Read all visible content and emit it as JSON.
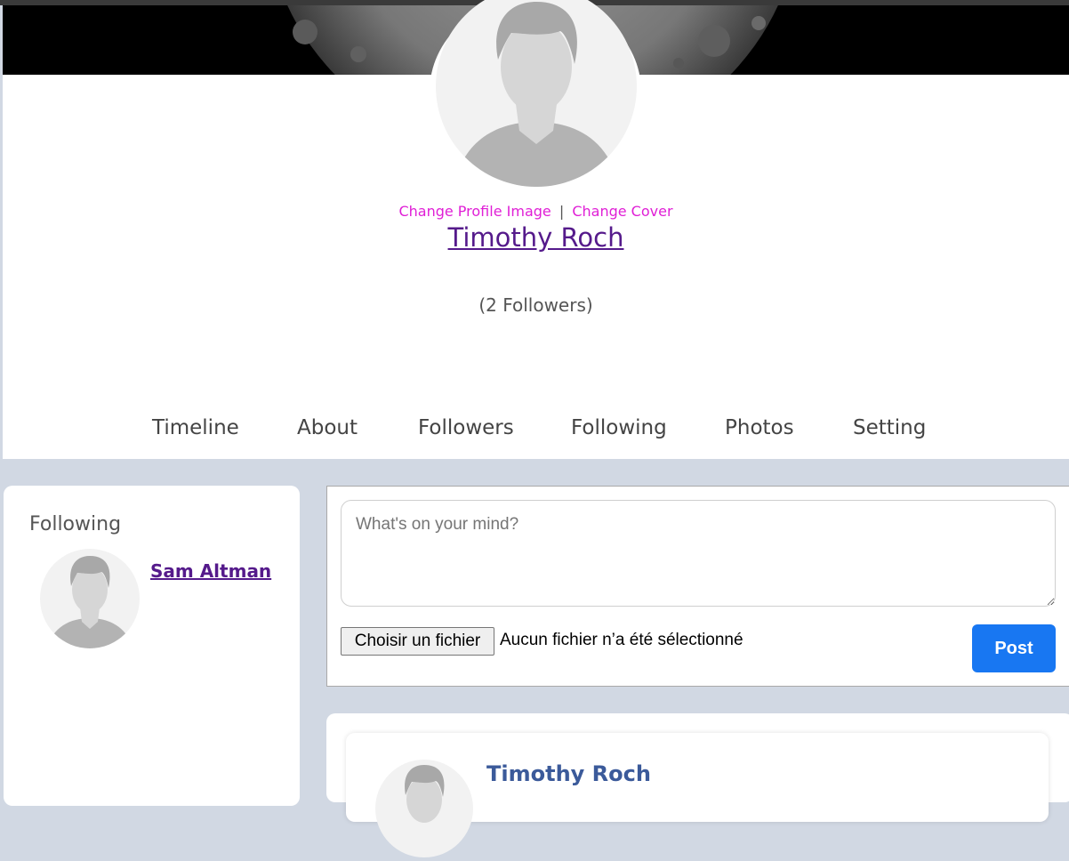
{
  "profile": {
    "change_profile_image": "Change Profile Image",
    "separator": "|",
    "change_cover": "Change Cover",
    "name": "Timothy Roch",
    "followers": "(2 Followers)"
  },
  "tabs": [
    {
      "label": "Timeline"
    },
    {
      "label": "About"
    },
    {
      "label": "Followers"
    },
    {
      "label": "Following"
    },
    {
      "label": "Photos"
    },
    {
      "label": "Setting"
    }
  ],
  "sidebar": {
    "title": "Following",
    "items": [
      {
        "name": "Sam Altman"
      }
    ]
  },
  "composer": {
    "placeholder": "What's on your mind?",
    "file_button": "Choisir un fichier",
    "file_status": "Aucun fichier n’a été sélectionné",
    "post_button": "Post"
  },
  "feed": {
    "posts": [
      {
        "author": "Timothy Roch"
      }
    ]
  },
  "colors": {
    "accent": "#1877f2",
    "link_visited": "#551a8b",
    "change_links": "#e01fd6",
    "post_author": "#3b5a9a",
    "page_bg": "#d1d8e3"
  },
  "icons": {
    "avatar": "default-user-avatar-icon",
    "cover": "moon-cover-image"
  }
}
